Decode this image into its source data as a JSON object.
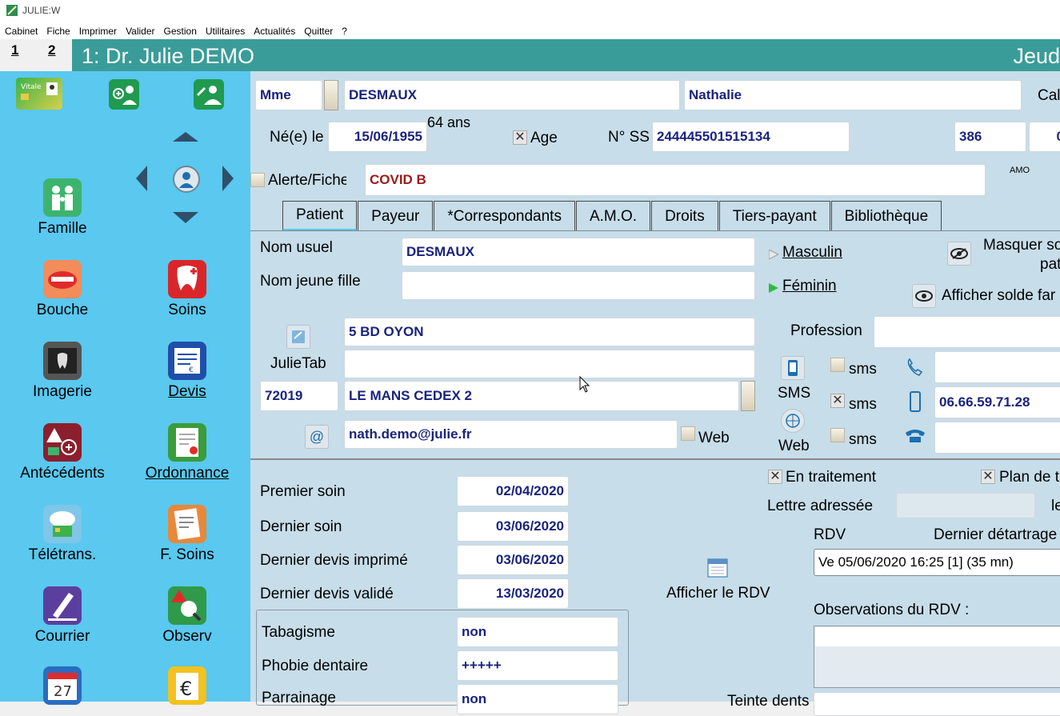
{
  "app": {
    "title": "JULIE:W"
  },
  "menu": [
    "Cabinet",
    "Fiche",
    "Imprimer",
    "Valider",
    "Gestion",
    "Utilitaires",
    "Actualités",
    "Quitter",
    "?"
  ],
  "doctor_tabs": [
    "1",
    "2"
  ],
  "header": {
    "title": "1: Dr. Julie DEMO",
    "day": "Jeud"
  },
  "sidebar": {
    "items": [
      {
        "label": "Famille",
        "icon": "family-icon",
        "color": "#3db46d"
      },
      {
        "label": "Bouche",
        "icon": "mouth-icon",
        "color": "#f28c5a"
      },
      {
        "label": "Soins",
        "icon": "tooth-care-icon",
        "color": "#d9262b"
      },
      {
        "label": "Imagerie",
        "icon": "xray-icon",
        "color": "#555555"
      },
      {
        "label": "Devis",
        "icon": "quote-icon",
        "color": "#1f4fa8"
      },
      {
        "label": "Antécédents",
        "icon": "history-icon",
        "color": "#8c1f2d"
      },
      {
        "label": "Ordonnance",
        "icon": "prescription-icon",
        "color": "#3a9c3a"
      },
      {
        "label": "Télétrans.",
        "icon": "teletransmission-icon",
        "color": "#7fc6e8"
      },
      {
        "label": "F. Soins",
        "icon": "care-sheet-icon",
        "color": "#e8883a"
      },
      {
        "label": "Courrier",
        "icon": "mail-pen-icon",
        "color": "#5b3f9e"
      },
      {
        "label": "Observ",
        "icon": "observation-icon",
        "color": "#2f9a4a"
      },
      {
        "label": "",
        "icon": "calendar-icon",
        "color": "#2a6cc0",
        "day": "27"
      },
      {
        "label": "",
        "icon": "euro-icon",
        "color": "#f2c21f"
      }
    ]
  },
  "patient": {
    "civility": "Mme",
    "last_name": "DESMAUX",
    "first_name": "Nathalie",
    "cal_label": "Cal",
    "born_label": "Né(e) le",
    "birth_date": "15/06/1955",
    "age_text": "64 ans",
    "age_label": "Age",
    "ss_label": "N° SS",
    "ss_number": "244445501515134",
    "ss_key": "386",
    "ss_extra": "0",
    "alert_label": "Alerte/Fiche",
    "alert_value": "COVID B",
    "amo_label": "AMO"
  },
  "tabs": [
    "Patient",
    "Payeur",
    "*Correspondants",
    "A.M.O.",
    "Droits",
    "Tiers-payant",
    "Bibliothèque"
  ],
  "details": {
    "usual_name_label": "Nom usuel",
    "usual_name": "DESMAUX",
    "maiden_name_label": "Nom jeune fille",
    "maiden_name": "",
    "male_label": "Masculin",
    "female_label": "Féminin",
    "hide_balance_label_1": "Masquer so",
    "hide_balance_label_2": "pat",
    "show_balance_label": "Afficher solde far",
    "address1": "5 BD OYON",
    "address2": "",
    "julietab_label": "JulieTab",
    "zip": "72019",
    "city": "LE MANS CEDEX 2",
    "email": "nath.demo@julie.fr",
    "web_label": "Web",
    "profession_label": "Profession",
    "profession": "",
    "sms_label": "SMS",
    "sms_small": "sms",
    "web_btn_label": "Web",
    "phone_home": "",
    "phone_mobile": "06.66.59.71.28",
    "phone_other": ""
  },
  "history": {
    "first_care_label": "Premier soin",
    "first_care": "02/04/2020",
    "last_care_label": "Dernier soin",
    "last_care": "03/06/2020",
    "last_quote_printed_label": "Dernier devis imprimé",
    "last_quote_printed": "03/06/2020",
    "last_quote_validated_label": "Dernier devis validé",
    "last_quote_validated": "13/03/2020",
    "smoking_label": "Tabagisme",
    "smoking": "non",
    "phobia_label": "Phobie dentaire",
    "phobia": "+++++",
    "sponsor_label": "Parrainage",
    "sponsor": "non"
  },
  "treatment": {
    "in_treatment_label": "En traitement",
    "plan_label": "Plan de t",
    "letter_label": "Lettre adressée",
    "letter_value": "",
    "letter_suffix": "le",
    "rdv_label": "RDV",
    "last_scaling_label": "Dernier détartrage",
    "rdv_value": "Ve 05/06/2020 16:25 [1] (35 mn)",
    "show_rdv_label": "Afficher le RDV",
    "rdv_obs_label": "Observations du RDV :",
    "teinte_label": "Teinte dents"
  }
}
